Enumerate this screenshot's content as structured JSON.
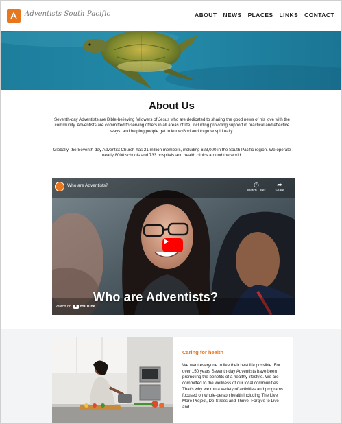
{
  "header": {
    "logo_text": "Adventists South Pacific",
    "nav": [
      "ABOUT",
      "NEWS",
      "PLACES",
      "LINKS",
      "CONTACT"
    ]
  },
  "about": {
    "title": "About Us",
    "paragraph1": "Seventh-day Adventists are Bible-believing followers of Jesus who are dedicated to sharing the good news of his love with the community. Adventists are committed to serving others in all areas of life, including providing support in practical and effective ways, and helping people get to know God and to grow spiritually.",
    "paragraph2": "Globally, the Seventh-day Adventist Church has 21 million members, including 623,000 in the South Pacific region. We operate nearly 8000 schools and 733 hospitals and health clinics around the world."
  },
  "video": {
    "title_small": "Who are Adventists?",
    "watch_later": "Watch Later",
    "share": "Share",
    "big_title": "Who are Adventists?",
    "watch_on": "Watch on",
    "youtube": "YouTube"
  },
  "card": {
    "heading": "Caring for health",
    "text": "We want everyone to live their best life possible. For over 150 years Seventh-day Adventists have been promoting the benefits of a healthy lifestyle. We are committed to the wellness of our local communities. That's why we run a variety of activities and programs focused on whole-person health including The Live More Project, De-Stress and Thrive, Forgive to Live and"
  },
  "colors": {
    "accent": "#e8761c",
    "youtube_red": "#ff0000"
  }
}
